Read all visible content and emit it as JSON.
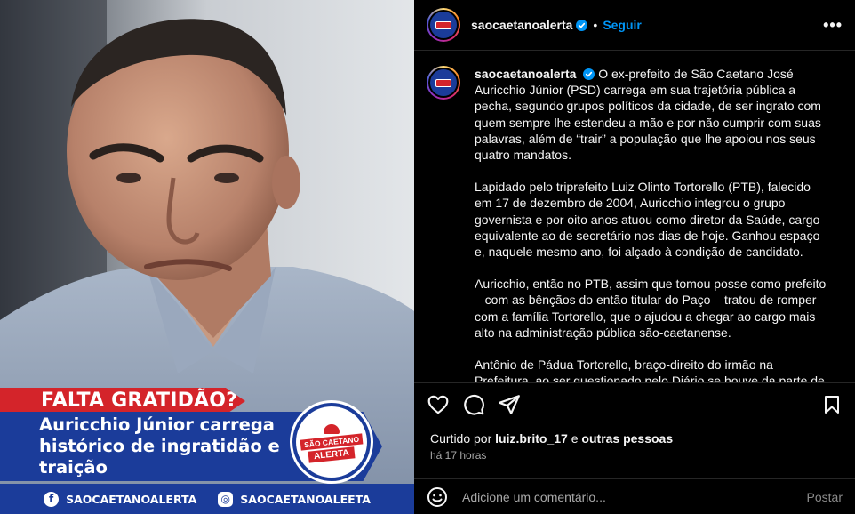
{
  "post": {
    "image": {
      "tag": "FALTA GRATIDÃO?",
      "headline_lines": [
        "Auricchio Júnior carrega",
        "histórico de ingratidão e",
        "traição"
      ],
      "badge_line1": "SÃO CAETANO",
      "badge_line2": "ALERTA",
      "social_facebook": "SAOCAETANOALERTA",
      "social_instagram": "SAOCAETANOALEETA"
    }
  },
  "header": {
    "username": "saocaetanoalerta",
    "separator": "•",
    "follow_label": "Seguir",
    "more_label": "•••"
  },
  "caption": {
    "username": "saocaetanoalerta",
    "paragraphs": [
      "O ex-prefeito de São Caetano José Auricchio Júnior (PSD) carrega em sua trajetória pública a pecha, segundo grupos políticos da cidade, de ser ingrato com quem sempre lhe estendeu a mão e por não cumprir com suas palavras, além de “trair” a população que lhe apoiou nos seus quatro mandatos.",
      "Lapidado pelo triprefeito Luiz Olinto Tortorello (PTB), falecido em 17 de dezembro de 2004, Auricchio integrou o grupo governista e por oito anos atuou como diretor da Saúde, cargo equivalente ao de secretário nos dias de hoje. Ganhou espaço e, naquele mesmo ano, foi alçado à condição de candidato.",
      "Auricchio, então no PTB, assim que tomou posse como prefeito – com as bênçãos do então titular do Paço – tratou de romper com a família Tortorello, que o ajudou a chegar ao cargo mais alto na administração pública são-caetanense.",
      "Antônio de Pádua Tortorello, braço-direito do irmão na Prefeitura, ao ser questionado pelo Diário se houve da parte de Auricchio um sinal de ingratidão ao afastar do seu círculo de"
    ]
  },
  "likes": {
    "prefix": "Curtido por",
    "user": "luiz.brito_17",
    "joiner": "e",
    "others": "outras pessoas"
  },
  "time": "há 17 horas",
  "comment": {
    "placeholder": "Adicione um comentário...",
    "post_label": "Postar"
  },
  "colors": {
    "brand_blue": "#1b3c9a",
    "brand_red": "#d4242a",
    "link_blue": "#0095f6"
  }
}
